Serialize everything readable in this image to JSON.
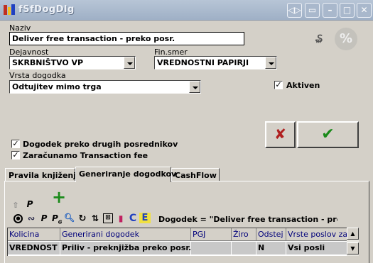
{
  "window": {
    "title": "fSfDogDlg"
  },
  "form": {
    "naziv_label": "Naziv",
    "naziv_value": "Deliver free transaction - preko posr.",
    "dejavnost_label": "Dejavnost",
    "dejavnost_value": "SKRBNIŠTVO VP",
    "finsmer_label": "Fin.smer",
    "finsmer_value": "VREDNOSTNI PAPIRJI",
    "vrsta_label": "Vrsta dogodka",
    "vrsta_value": "Odtujitev mimo trga",
    "aktiven_label": "Aktiven",
    "aktiven_checked": true,
    "preko_label": "Dogodek preko drugih posrednikov",
    "preko_checked": true,
    "fee_label": "Zaračunamo Transaction fee",
    "fee_checked": true
  },
  "buttons": {
    "cancel_glyph": "✘",
    "ok_glyph": "✔"
  },
  "tabs": [
    "Pravila knjiženja",
    "Generiranje dogodkov",
    "CashFlow"
  ],
  "toolbar": {
    "p_label": "P",
    "info": "Dogodek = \"Deliver free transaction - preko po"
  },
  "grid": {
    "columns": [
      "Kolicina",
      "Generirani dogodek",
      "PGJ",
      "Žiro",
      "Odstej",
      "Vrste poslov za i..."
    ],
    "rows": [
      [
        "VREDNOST",
        "Priliv - preknjižba preko posr.",
        "",
        "",
        "N",
        "Vsi posli"
      ]
    ]
  },
  "colors": {
    "accent_green": "#1a8a1a",
    "cancel_red": "#b02020"
  }
}
